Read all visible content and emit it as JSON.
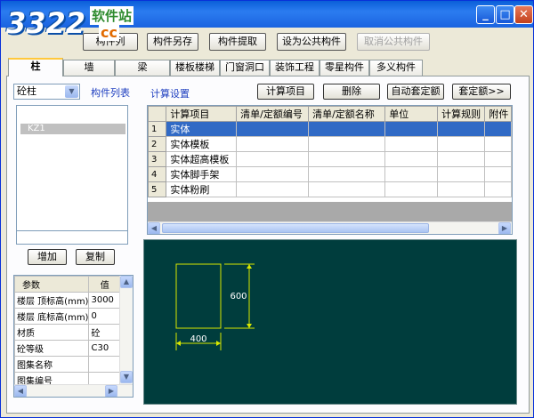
{
  "logo": {
    "number": "3322",
    "site": "软件站",
    "domain": "cc"
  },
  "toolbar": {
    "hidden_button_label": "构件列",
    "save_as_label": "构件另存",
    "extract_label": "构件提取",
    "set_public_label": "设为公共构件",
    "cancel_public_label": "取消公共构件"
  },
  "tabs": [
    "柱",
    "墙",
    "梁",
    "楼板楼梯",
    "门窗洞口",
    "装饰工程",
    "零星构件",
    "多义构件"
  ],
  "left": {
    "type_select": "砼柱",
    "list_title": "构件列表",
    "list_items": [
      "KZ1"
    ],
    "add_label": "增加",
    "copy_label": "复制"
  },
  "props": {
    "header": [
      "参数",
      "值"
    ],
    "rows": [
      {
        "k": "楼层 顶标高(mm)",
        "v": "3000"
      },
      {
        "k": "楼层 底标高(mm)",
        "v": "0"
      },
      {
        "k": "材质",
        "v": "砼"
      },
      {
        "k": "砼等级",
        "v": "C30"
      },
      {
        "k": "图集名称",
        "v": ""
      },
      {
        "k": "图集编号",
        "v": ""
      }
    ]
  },
  "calc": {
    "title": "计算设置",
    "add_item_label": "计算项目",
    "delete_label": "删除",
    "auto_quota_label": "自动套定额",
    "quota_label": "套定额>>",
    "columns": [
      "计算项目",
      "清单/定额编号",
      "清单/定额名称",
      "单位",
      "计算规则",
      "附件"
    ],
    "rows": [
      {
        "n": "1",
        "item": "实体"
      },
      {
        "n": "2",
        "item": "实体模板"
      },
      {
        "n": "3",
        "item": "实体超高模板"
      },
      {
        "n": "4",
        "item": "实体脚手架"
      },
      {
        "n": "5",
        "item": "实体粉刷"
      }
    ]
  },
  "drawing": {
    "width_label": "400",
    "height_label": "600",
    "line_color": "#d8e800",
    "background": "#003d3d"
  },
  "title_buttons": [
    "minimize-icon",
    "maximize-icon",
    "close-icon"
  ]
}
